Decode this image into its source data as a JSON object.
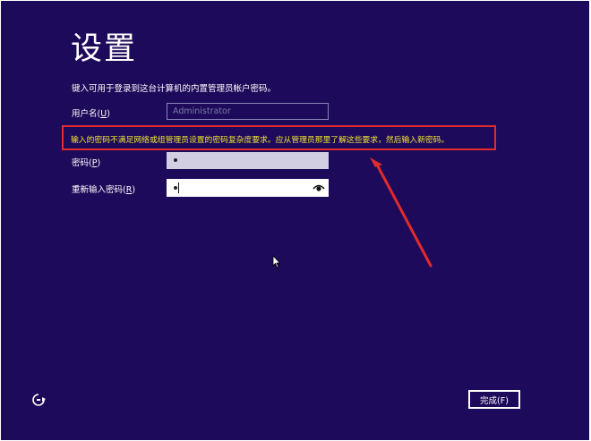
{
  "page": {
    "title": "设置",
    "subtitle": "键入可用于登录到这台计算机的内置管理员帐户密码。",
    "corner_text": "■"
  },
  "form": {
    "username_label": "用户名(",
    "username_key": "U",
    "username_label_end": ")",
    "username_value": "Administrator",
    "password_label": "密码(",
    "password_key": "P",
    "password_label_end": ")",
    "reenter_label": "重新输入密码(",
    "reenter_key": "R",
    "reenter_label_end": ")"
  },
  "error": {
    "message": "输入的密码不满足网络或组管理员设置的密码复杂度要求。应从管理员那里了解这些要求，然后输入新密码。"
  },
  "footer": {
    "finish_label": "完成(F)"
  },
  "colors": {
    "background": "#1e0a5a",
    "error_border": "#e22b2b",
    "error_text": "#f0e430",
    "annotation_arrow": "#e22b2b"
  },
  "icons": {
    "reveal": "eye-icon",
    "accessibility": "ease-of-access-icon"
  }
}
